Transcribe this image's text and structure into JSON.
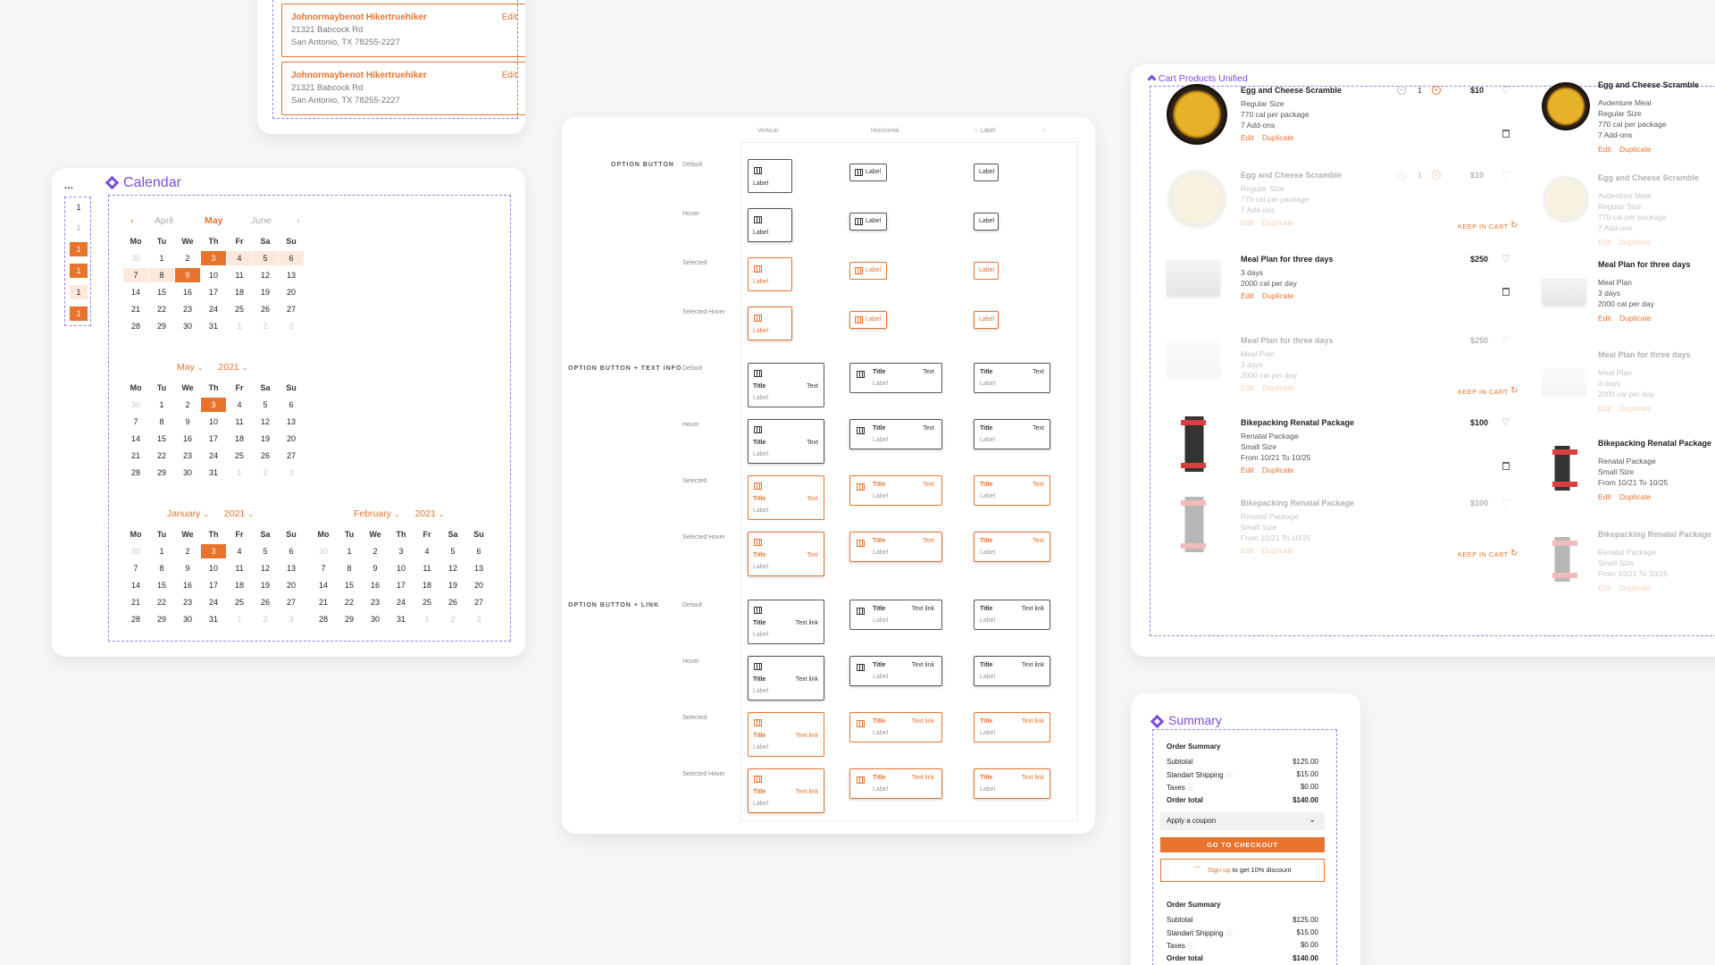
{
  "address": {
    "items": [
      {
        "name": "Johnormaybenot Hikertruehiker",
        "line1": "21321 Babcock Rd",
        "line2": "San Antonio, TX 78255-2227",
        "edit": "Edit"
      },
      {
        "name": "Johnormaybenot Hikertruehiker",
        "line1": "21321 Babcock Rd",
        "line2": "San Antonio, TX 78255-2227",
        "edit": "Edit"
      }
    ]
  },
  "calendar": {
    "title": "Calendar",
    "more": "...",
    "mini": [
      "1",
      "1",
      "1",
      "1",
      "1",
      "1"
    ],
    "dow": [
      "Mo",
      "Tu",
      "We",
      "Th",
      "Fr",
      "Sa",
      "Su"
    ],
    "top": {
      "prev_arrow": "‹",
      "next_arrow": "›",
      "months": [
        "April",
        "May",
        "June"
      ]
    },
    "may": {
      "month": "May",
      "year": "2021"
    },
    "jan": {
      "month": "January",
      "year": "2021"
    },
    "feb": {
      "month": "February",
      "year": "2021"
    },
    "rows_a": [
      [
        "30",
        "1",
        "2",
        "3",
        "4",
        "5",
        "6"
      ],
      [
        "7",
        "8",
        "9",
        "10",
        "11",
        "12",
        "13"
      ],
      [
        "14",
        "15",
        "16",
        "17",
        "18",
        "19",
        "20"
      ],
      [
        "21",
        "22",
        "23",
        "24",
        "25",
        "26",
        "27"
      ],
      [
        "28",
        "29",
        "30",
        "31",
        "1",
        "2",
        "3"
      ]
    ],
    "rows_b": [
      [
        "30",
        "1",
        "2",
        "3",
        "4",
        "5",
        "6"
      ],
      [
        "7",
        "8",
        "9",
        "10",
        "11",
        "12",
        "13"
      ],
      [
        "14",
        "15",
        "16",
        "17",
        "18",
        "19",
        "20"
      ],
      [
        "21",
        "22",
        "23",
        "24",
        "25",
        "26",
        "27"
      ],
      [
        "28",
        "29",
        "30",
        "31",
        "1",
        "2",
        "3"
      ]
    ],
    "rows_feb": [
      [
        "30",
        "1",
        "2",
        "3",
        "4",
        "5",
        "6"
      ],
      [
        "7",
        "8",
        "9",
        "10",
        "11",
        "12",
        "13"
      ],
      [
        "14",
        "15",
        "16",
        "17",
        "18",
        "19",
        "20"
      ],
      [
        "21",
        "22",
        "23",
        "24",
        "25",
        "26",
        "27"
      ],
      [
        "28",
        "29",
        "30",
        "31",
        "1",
        "2",
        "3"
      ]
    ]
  },
  "options": {
    "columns": [
      "Vertical",
      "Horizontal",
      "Label"
    ],
    "sections": [
      "OPTION BUTTON",
      "OPTION BUTTON + TEXT INFO",
      "OPTION BUTTON + LINK"
    ],
    "states": [
      "Default",
      "Hover",
      "Selected",
      "Selected Hover"
    ],
    "label": "Label",
    "title": "Title",
    "text": "Text",
    "text_link": "Text link"
  },
  "cart": {
    "title": "Cart Products Unified",
    "edit": "Edit",
    "duplicate": "Duplicate",
    "keep": "KEEP IN CART",
    "qty": "1",
    "products": [
      {
        "name": "Egg and Cheese Scramble",
        "lines": [
          "Regular Size",
          "770 cal per package",
          "7 Add-ons"
        ],
        "price": "$10"
      },
      {
        "name": "Egg and Cheese Scramble",
        "lines": [
          "Regular Size",
          "770 cal per package",
          "7 Add-ons"
        ],
        "price": "$10"
      },
      {
        "name": "Meal Plan for three days",
        "lines": [
          "3 days",
          "2000 cal per day"
        ],
        "price": "$250"
      },
      {
        "name": "Meal Plan for three days",
        "lines": [
          "Meal Plan",
          "3 days",
          "2000 cal per day"
        ],
        "price": "$250"
      },
      {
        "name": "Bikepacking Renatal Package",
        "lines": [
          "Renatal Package",
          "Small Size",
          "From 10/21 To 10/25"
        ],
        "price": "$100"
      },
      {
        "name": "Bikepacking Renatal Package",
        "lines": [
          "Renatal Package",
          "Small Size",
          "From 10/21 To 10/25"
        ],
        "price": "$100"
      }
    ],
    "side": [
      {
        "name": "Egg and Cheese Scramble",
        "lines": [
          "Avdenture Meal",
          "Regular Size",
          "770 cal per package",
          "7 Add-ons"
        ]
      },
      {
        "name": "Egg and Cheese Scramble",
        "lines": [
          "Avdenture Meal",
          "Regular Size",
          "770 cal per package",
          "7 Add-ons"
        ]
      },
      {
        "name": "Meal Plan for three days",
        "lines": [
          "Meal Plan",
          "3 days",
          "2000 cal per day"
        ]
      },
      {
        "name": "Meal Plan for three days",
        "lines": [
          "Meal Plan",
          "3 days",
          "2000 cal per day"
        ]
      },
      {
        "name": "Bikepacking Renatal Package",
        "lines": [
          "Renatal Package",
          "Small Size",
          "From 10/21 To 10/25"
        ]
      },
      {
        "name": "Bikepacking Renatal Package",
        "lines": [
          "Renatal Package",
          "Small Size",
          "From 10/21 To 10/25"
        ]
      }
    ]
  },
  "summary": {
    "title": "Summary",
    "heading": "Order Summary",
    "subtotal_label": "Subtotal",
    "subtotal": "$125.00",
    "shipping_label": "Standart Shipping",
    "shipping": "$15.00",
    "taxes_label": "Taxes",
    "taxes": "$0.00",
    "total_label": "Order total",
    "total": "$140.00",
    "coupon": "Apply a coupon",
    "checkout": "GO TO CHECKOUT",
    "signup_link": "Sign up",
    "signup_rest": " to get 10% discount"
  },
  "colors": {
    "accent": "#e8732c",
    "brand": "#7b4ce2"
  }
}
